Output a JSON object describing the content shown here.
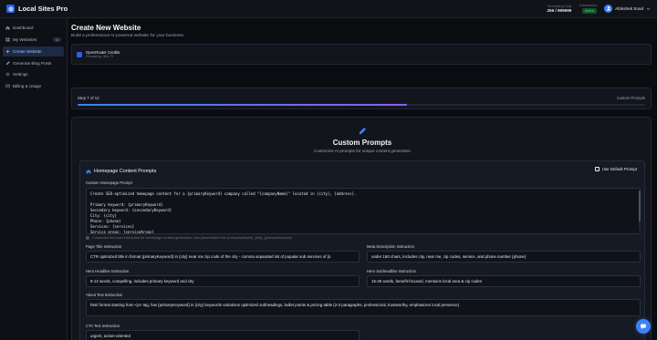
{
  "app": {
    "title": "Local Sites Pro"
  },
  "topbar": {
    "daily_label": "Remaining Daily",
    "daily_value": "256 / 999999",
    "subscription_label": "Subscription",
    "subscription_value": "Active",
    "user_name": "Abhishek Sood"
  },
  "sidebar": {
    "items": [
      {
        "label": "Dashboard",
        "icon": "home-icon"
      },
      {
        "label": "My Websites",
        "icon": "grid-icon",
        "badge": "10"
      },
      {
        "label": "Create Website",
        "icon": "plus-icon",
        "active": true
      },
      {
        "label": "Generate Blog Posts",
        "icon": "pen-icon"
      },
      {
        "label": "Settings",
        "icon": "gear-icon"
      },
      {
        "label": "Billing & Usage",
        "icon": "card-icon"
      }
    ]
  },
  "page": {
    "title": "Create New Website",
    "subtitle": "Build a professional AI-powered website for your business."
  },
  "credits": {
    "title": "OpenRouter Credits",
    "subtitle": "Remaining: $58.79"
  },
  "step": {
    "label": "Step 7 of 12",
    "name": "Custom Prompts",
    "progress": 0.58
  },
  "custom_prompts": {
    "title": "Custom Prompts",
    "subtitle": "Customize AI prompts for unique content generation",
    "section_title": "Homepage Content Prompts",
    "default_button": "Use Default Prompt",
    "homepage_label": "Custom Homepage Prompt",
    "homepage_prompt": "Create SEO-optimized homepage content for a {primaryKeyword} company called \"{companyName}\" located in {city}, {address}.\n\nPrimary keyword: {primaryKeyword}\nSecondary keyword: {secondaryKeyword}\nCity: {city}\nPhone: {phone}\nServices: {services}\nService areas: {serviceAreas}\nZip codes: {zipCodes}",
    "hint": "Customize the main instruction for homepage content generation. Use placeholders like {companyName}, {city}, {primaryKeyword}.",
    "fields": {
      "page_title": {
        "label": "Page Title Instruction",
        "value": "CTR optimized title in format {primaryKeyword} in {city} near me zip code of the city - comma separated list of popular sub services of {s"
      },
      "meta": {
        "label": "Meta Description Instruction",
        "value": "under 160 chars, includes city, near me, zip codes, service, and phone number {phone}"
      },
      "hero_headline": {
        "label": "Hero Headline Instruction",
        "value": "8-12 words, compelling, includes primary keyword and city"
      },
      "hero_subheadline": {
        "label": "Hero Subheadline Instruction",
        "value": "15-25 words, benefit-focused, mentions local area & zip codes"
      },
      "about": {
        "label": "About Text Instruction",
        "value": "html format starting from <p> tag, few {primaryKeyword} in {city} keywords variations optimized subheadings, bullet points & pricing table (2-3 paragraphs, professional, trustworthy, emphasizes local presence)"
      },
      "cta": {
        "label": "CTA Text Instruction",
        "value": "urgent, action-oriented"
      }
    }
  },
  "colors": {
    "accent": "#3b82f6",
    "active_badge": "#4ade80",
    "background": "#0b0c10"
  }
}
